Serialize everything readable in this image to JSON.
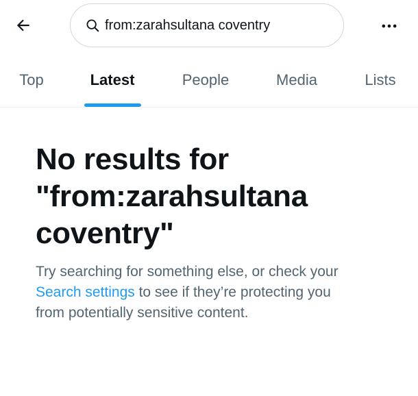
{
  "header": {
    "back_icon": "arrow-left-icon",
    "search": {
      "value": "from:zarahsultana coventry",
      "icon": "search-icon"
    },
    "more_icon": "more-horizontal-icon"
  },
  "tabs": [
    {
      "label": "Top",
      "active": false
    },
    {
      "label": "Latest",
      "active": true
    },
    {
      "label": "People",
      "active": false
    },
    {
      "label": "Media",
      "active": false
    },
    {
      "label": "Lists",
      "active": false
    }
  ],
  "empty_state": {
    "title_line1": "No results for",
    "title_line2": "\"from:zarahsultana",
    "title_line3": "coventry\"",
    "body_line1": "Try searching for something else, or check your",
    "link_text": "Search settings",
    "body_line2_rest": " to see if they’re protecting you",
    "body_line3": "from potentially sensitive content."
  },
  "colors": {
    "accent": "#1d9bf0",
    "text_primary": "#0f1419",
    "text_secondary": "#536471",
    "border": "#cfd9de"
  }
}
